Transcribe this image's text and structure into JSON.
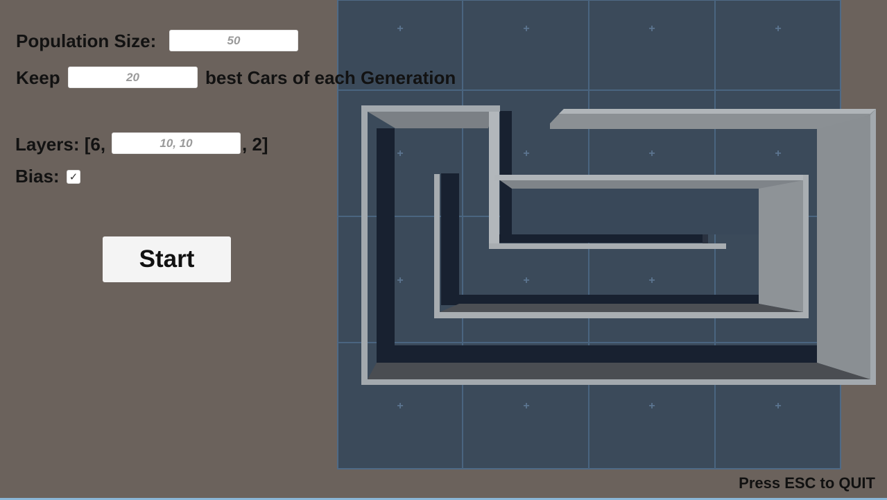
{
  "population": {
    "label": "Population Size:",
    "value": "50"
  },
  "keep": {
    "prefix": "Keep",
    "value": "20",
    "suffix": "best Cars of each Generation"
  },
  "layers": {
    "prefix": "Layers: [6,",
    "value": "10, 10",
    "suffix": ", 2]"
  },
  "bias": {
    "label": "Bias:",
    "checked": true,
    "check_glyph": "✓"
  },
  "start": {
    "label": "Start"
  },
  "footer": {
    "quit_hint": "Press ESC to QUIT"
  },
  "colors": {
    "background": "#6b625c",
    "floor": "#3b4a5a",
    "wall": "#a0a6ab",
    "grid_line": "#4a6580"
  }
}
